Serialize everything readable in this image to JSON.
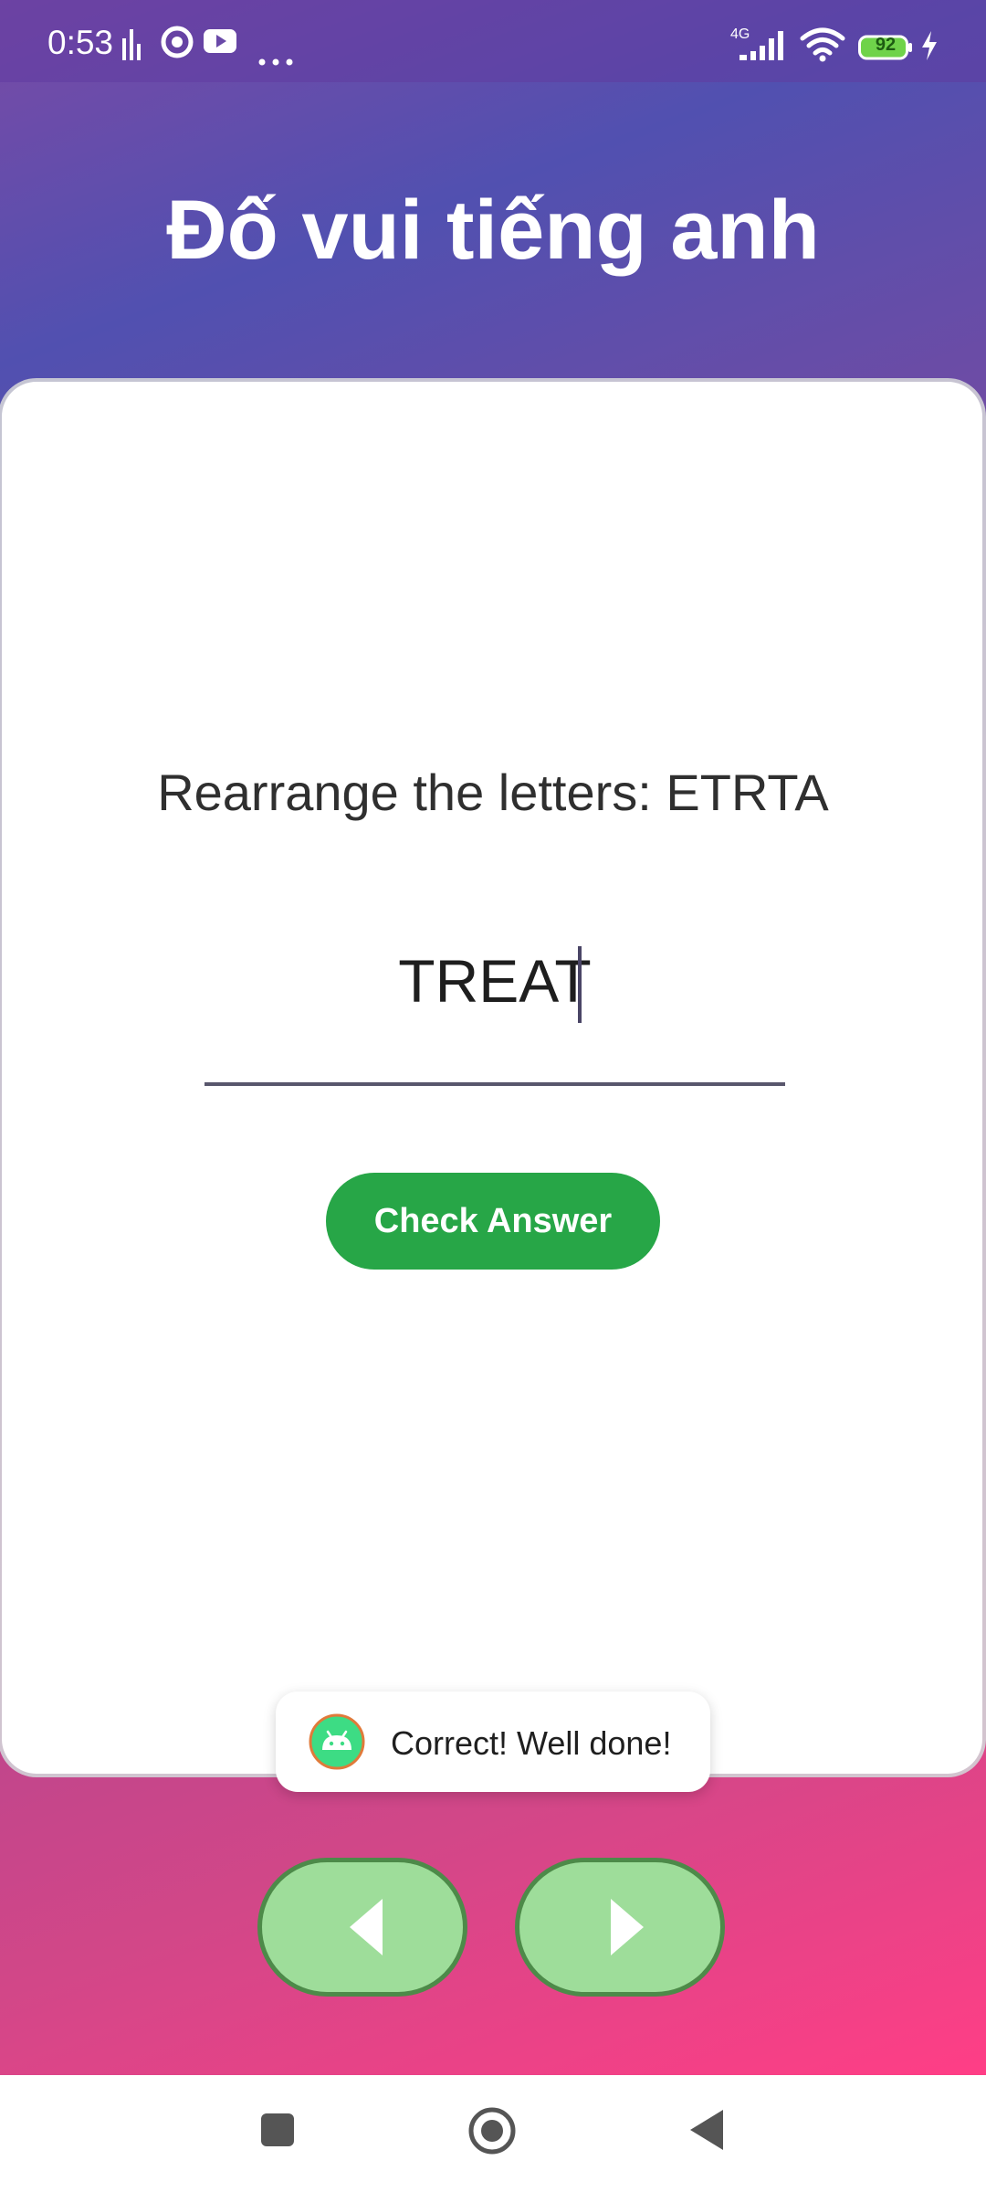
{
  "status_bar": {
    "time": "0:53",
    "network": "4G",
    "battery": "92"
  },
  "app": {
    "title": "Đố vui tiếng anh"
  },
  "quiz": {
    "prompt": "Rearrange the letters: ETRTA",
    "answer_value": "TREAT",
    "check_button_label": "Check Answer"
  },
  "toast": {
    "message": "Correct! Well done!"
  },
  "navigation": {
    "prev_icon": "arrow-left-icon",
    "next_icon": "arrow-right-icon"
  },
  "colors": {
    "check_button": "#27a647",
    "nav_button_fill": "#9edd9a",
    "nav_button_border": "#4d8a49"
  }
}
